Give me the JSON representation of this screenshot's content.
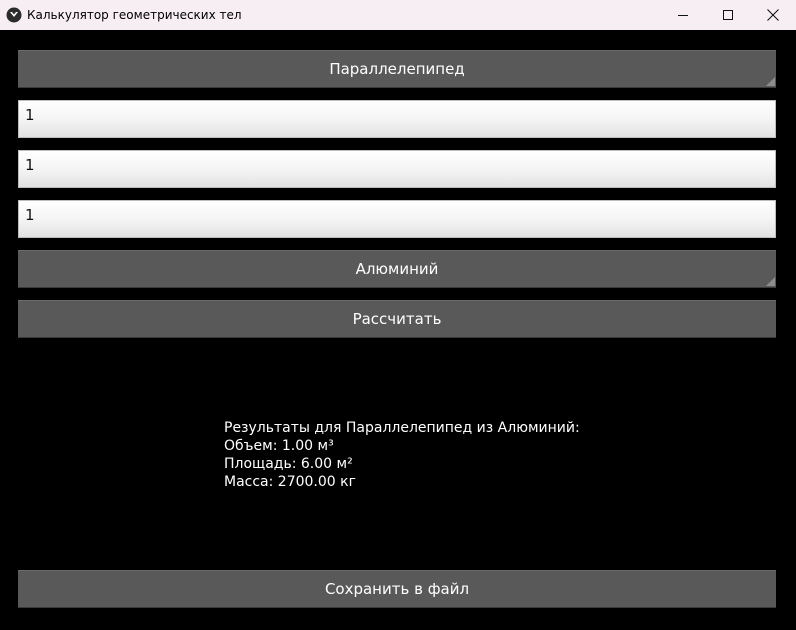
{
  "window": {
    "title": "Калькулятор геометрических тел",
    "icon": "kivy-icon"
  },
  "controls": {
    "minimize": "minimize-icon",
    "maximize": "maximize-icon",
    "close": "close-icon"
  },
  "form": {
    "shape_select": "Параллелепипед",
    "inputs": [
      "1",
      "1",
      "1"
    ],
    "material_select": "Алюминий",
    "calculate_label": "Рассчитать"
  },
  "results": {
    "header": "Результаты для Параллелепипед из Алюминий:",
    "volume": "Объем: 1.00 м³",
    "area": "Площадь: 6.00 м²",
    "mass": "Масса: 2700.00 кг"
  },
  "footer": {
    "save_label": "Сохранить в файл"
  }
}
